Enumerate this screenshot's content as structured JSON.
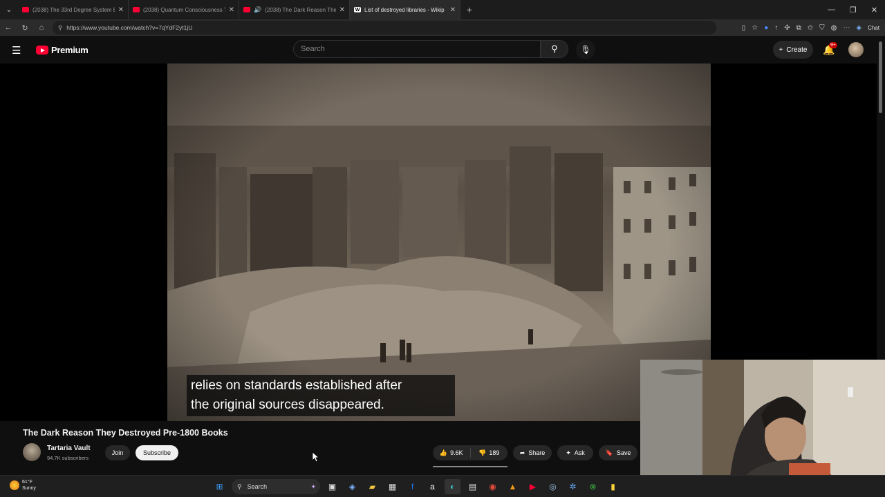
{
  "browser": {
    "tabs": [
      {
        "title": "(2038) The 33rd Degree System E",
        "favicon": "youtube"
      },
      {
        "title": "(2038) Quantum Consciousness T",
        "favicon": "youtube"
      },
      {
        "title": "(2038) The Dark Reason They",
        "favicon": "youtube",
        "audio": true
      },
      {
        "title": "List of destroyed libraries - Wikip",
        "favicon": "wikipedia",
        "active": true
      }
    ],
    "url": "https://www.youtube.com/watch?v=7qYdF2yt1jU",
    "chat_label": "Chat"
  },
  "youtube": {
    "logo_text": "Premium",
    "search_placeholder": "Search",
    "create_label": "Create",
    "notif_badge": "9+",
    "caption_line1": "relies on standards established after",
    "caption_line2": "the original sources disappeared.",
    "video_title": "The Dark Reason They Destroyed Pre-1800 Books",
    "channel_name": "Tartaria Vault",
    "channel_subs": "94.7K subscribers",
    "join_label": "Join",
    "subscribe_label": "Subscribe",
    "likes": "9.6K",
    "dislikes": "189",
    "share_label": "Share",
    "ask_label": "Ask",
    "save_label": "Save"
  },
  "taskbar": {
    "temp": "61°F",
    "weather": "Sunny",
    "search_label": "Search"
  },
  "colors": {
    "brand_red": "#ff0033",
    "background": "#0f0f0f",
    "subscribe_bg": "#f1f1f1"
  }
}
